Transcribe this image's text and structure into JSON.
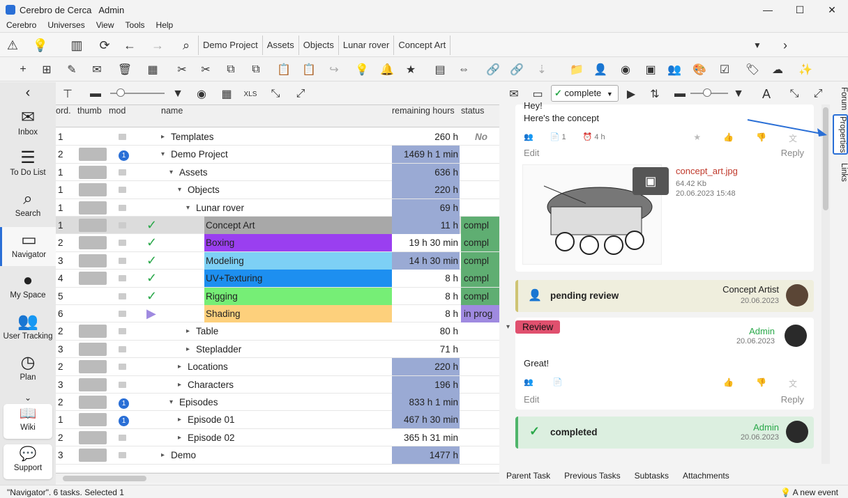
{
  "app": {
    "title": "Cerebro de Cerca",
    "user": "Admin"
  },
  "menu": [
    "Cerebro",
    "Universes",
    "View",
    "Tools",
    "Help"
  ],
  "breadcrumbs": [
    "Demo Project",
    "Assets",
    "Objects",
    "Lunar rover",
    "Concept Art"
  ],
  "sidebar": {
    "items": [
      {
        "label": "Inbox",
        "icon": "envelope-icon",
        "glyph": "✉"
      },
      {
        "label": "To Do List",
        "icon": "list-icon",
        "glyph": "☰"
      },
      {
        "label": "Search",
        "icon": "search-icon",
        "glyph": "⌕"
      },
      {
        "label": "Navigator",
        "icon": "folder-icon",
        "glyph": "▭"
      },
      {
        "label": "My Space",
        "icon": "globe-icon",
        "glyph": "●"
      },
      {
        "label": "User Tracking",
        "icon": "users-icon",
        "glyph": "👥"
      },
      {
        "label": "Plan",
        "icon": "clock-icon",
        "glyph": "◷"
      }
    ],
    "wiki": "Wiki",
    "support": "Support"
  },
  "grid": {
    "columns": {
      "ord": "ord.",
      "thumb": "thumb",
      "mod": "mod",
      "name": "name",
      "hours": "remaining hours",
      "status": "status"
    },
    "rows": [
      {
        "ord": "1",
        "name": "Templates",
        "hours": "260 h",
        "status": "No sta",
        "depth": 0,
        "arrow": "▸",
        "bg": "",
        "hbg": "",
        "check": "",
        "badge": ""
      },
      {
        "ord": "2",
        "name": "Demo Project",
        "hours": "1469 h 1 min",
        "status": "",
        "depth": 0,
        "arrow": "▾",
        "bg": "",
        "hbg": "#9aaad4",
        "check": "",
        "badge": "1"
      },
      {
        "ord": "1",
        "name": "Assets",
        "hours": "636 h",
        "status": "",
        "depth": 1,
        "arrow": "▾",
        "bg": "",
        "hbg": "#9aaad4",
        "check": "",
        "badge": ""
      },
      {
        "ord": "1",
        "name": "Objects",
        "hours": "220 h",
        "status": "",
        "depth": 2,
        "arrow": "▾",
        "bg": "",
        "hbg": "#9aaad4",
        "check": "",
        "badge": ""
      },
      {
        "ord": "1",
        "name": "Lunar rover",
        "hours": "69 h",
        "status": "",
        "depth": 3,
        "arrow": "▾",
        "bg": "",
        "hbg": "#9aaad4",
        "check": "",
        "badge": ""
      },
      {
        "ord": "1",
        "name": "Concept Art",
        "hours": "11 h",
        "status": "compl",
        "depth": 4,
        "arrow": "",
        "bg": "#a8a8a8",
        "hbg": "#9aaad4",
        "check": "✓",
        "badge": ""
      },
      {
        "ord": "2",
        "name": "Boxing",
        "hours": "19 h 30 min",
        "status": "compl",
        "depth": 4,
        "arrow": "",
        "bg": "#9a3ff0",
        "hbg": "",
        "check": "✓",
        "badge": ""
      },
      {
        "ord": "3",
        "name": "Modeling",
        "hours": "14 h 30 min",
        "status": "compl",
        "depth": 4,
        "arrow": "",
        "bg": "#7dd0f5",
        "hbg": "#9aaad4",
        "check": "✓",
        "badge": ""
      },
      {
        "ord": "4",
        "name": "UV+Texturing",
        "hours": "8 h",
        "status": "compl",
        "depth": 4,
        "arrow": "",
        "bg": "#1d8ff0",
        "hbg": "",
        "check": "✓",
        "badge": ""
      },
      {
        "ord": "5",
        "name": "Rigging",
        "hours": "8 h",
        "status": "compl",
        "depth": 4,
        "arrow": "",
        "bg": "#76ee76",
        "hbg": "",
        "check": "✓",
        "badge": ""
      },
      {
        "ord": "6",
        "name": "Shading",
        "hours": "8 h",
        "status": "in prog",
        "depth": 4,
        "arrow": "",
        "bg": "#fdd07c",
        "hbg": "",
        "check": "▶",
        "badge": ""
      },
      {
        "ord": "2",
        "name": "Table",
        "hours": "80 h",
        "status": "",
        "depth": 3,
        "arrow": "▸",
        "bg": "",
        "hbg": "",
        "check": "",
        "badge": ""
      },
      {
        "ord": "3",
        "name": "Stepladder",
        "hours": "71 h",
        "status": "",
        "depth": 3,
        "arrow": "▸",
        "bg": "",
        "hbg": "",
        "check": "",
        "badge": ""
      },
      {
        "ord": "2",
        "name": "Locations",
        "hours": "220 h",
        "status": "",
        "depth": 2,
        "arrow": "▸",
        "bg": "",
        "hbg": "#9aaad4",
        "check": "",
        "badge": ""
      },
      {
        "ord": "3",
        "name": "Characters",
        "hours": "196 h",
        "status": "",
        "depth": 2,
        "arrow": "▸",
        "bg": "",
        "hbg": "#9aaad4",
        "check": "",
        "badge": ""
      },
      {
        "ord": "2",
        "name": "Episodes",
        "hours": "833 h 1 min",
        "status": "",
        "depth": 1,
        "arrow": "▾",
        "bg": "",
        "hbg": "#9aaad4",
        "check": "",
        "badge": "1"
      },
      {
        "ord": "1",
        "name": "Episode 01",
        "hours": "467 h 30 min",
        "status": "",
        "depth": 2,
        "arrow": "▸",
        "bg": "",
        "hbg": "#9aaad4",
        "check": "",
        "badge": "1"
      },
      {
        "ord": "2",
        "name": "Episode 02",
        "hours": "365 h 31 min",
        "status": "",
        "depth": 2,
        "arrow": "▸",
        "bg": "",
        "hbg": "",
        "check": "",
        "badge": ""
      },
      {
        "ord": "3",
        "name": "Demo",
        "hours": "1477 h",
        "status": "",
        "depth": 0,
        "arrow": "▸",
        "bg": "",
        "hbg": "#9aaad4",
        "check": "",
        "badge": ""
      }
    ]
  },
  "forum": {
    "status_select": "complete",
    "msg1": {
      "line1": "Hey!",
      "line2": "Here's the concept",
      "attach_count": "1",
      "time": "4 h",
      "edit": "Edit",
      "reply": "Reply"
    },
    "attachment": {
      "name": "concept_art.jpg",
      "size": "64.42 Kb",
      "date": "20.06.2023 15:48"
    },
    "pending": {
      "label": "pending review",
      "author": "Concept Artist",
      "date": "20.06.2023"
    },
    "review": {
      "tag": "Review",
      "author": "Admin",
      "date": "20.06.2023",
      "text": "Great!",
      "edit": "Edit",
      "reply": "Reply"
    },
    "completed": {
      "label": "completed",
      "author": "Admin",
      "date": "20.06.2023"
    },
    "tabs": [
      "Parent Task",
      "Previous Tasks",
      "Subtasks",
      "Attachments"
    ]
  },
  "vtabs": [
    "Forum",
    "Properties",
    "Links"
  ],
  "statusbar": {
    "left": "\"Navigator\". 6 tasks. Selected 1",
    "right": "A new event"
  },
  "colors": {
    "accent": "#2a6fd6",
    "review": "#e0506e",
    "complete_green": "#2aa84a",
    "pending_bg": "#efeedd",
    "completed_bg": "#dcefe0"
  }
}
